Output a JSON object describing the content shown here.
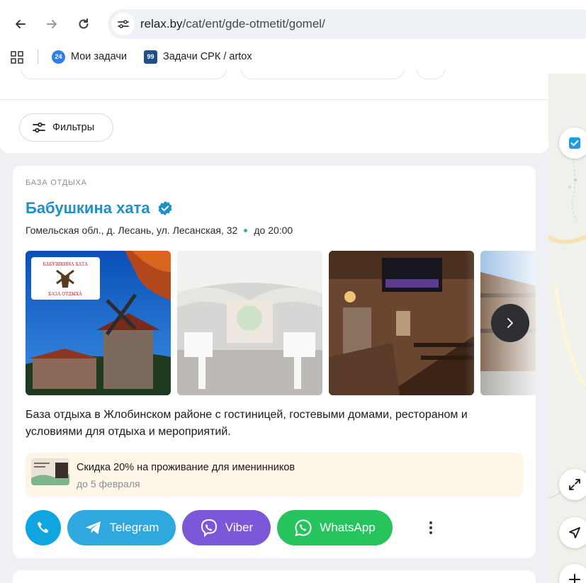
{
  "browser": {
    "url_domain": "relax.by",
    "url_path": "/cat/ent/gde-otmetit/gomel/",
    "bookmarks": [
      {
        "badge": "24",
        "label": "Мои задачи"
      },
      {
        "badge": "99",
        "label": "Задачи СРК / artox"
      }
    ]
  },
  "filters": {
    "label": "Фильтры"
  },
  "listing": {
    "category": "БАЗА ОТДЫХА",
    "title": "Бабушкина хата",
    "address": "Гомельская обл., д. Лесань, ул. Лесанская, 32",
    "hours": "до 20:00",
    "logo_text_top": "БАБУШКИНА ХАТА",
    "logo_text_bottom": "БАЗА ОТДЫХА",
    "description": "База отдыха в Жлобинском районе с гостиницей, гостевыми домами, рестораном и условиями для отдыха и мероприятий.",
    "promo": {
      "title": "Скидка 20% на проживание для именинников",
      "date": "до 5 февраля"
    },
    "actions": {
      "telegram": "Telegram",
      "viber": "Viber",
      "whatsapp": "WhatsApp"
    }
  },
  "colors": {
    "accent_title": "#1e8fc9",
    "phone": "#0ea5e0",
    "telegram": "#2fa7df",
    "viber": "#7b58d8",
    "whatsapp": "#27c45d",
    "promo_bg": "#fdf6e6"
  }
}
